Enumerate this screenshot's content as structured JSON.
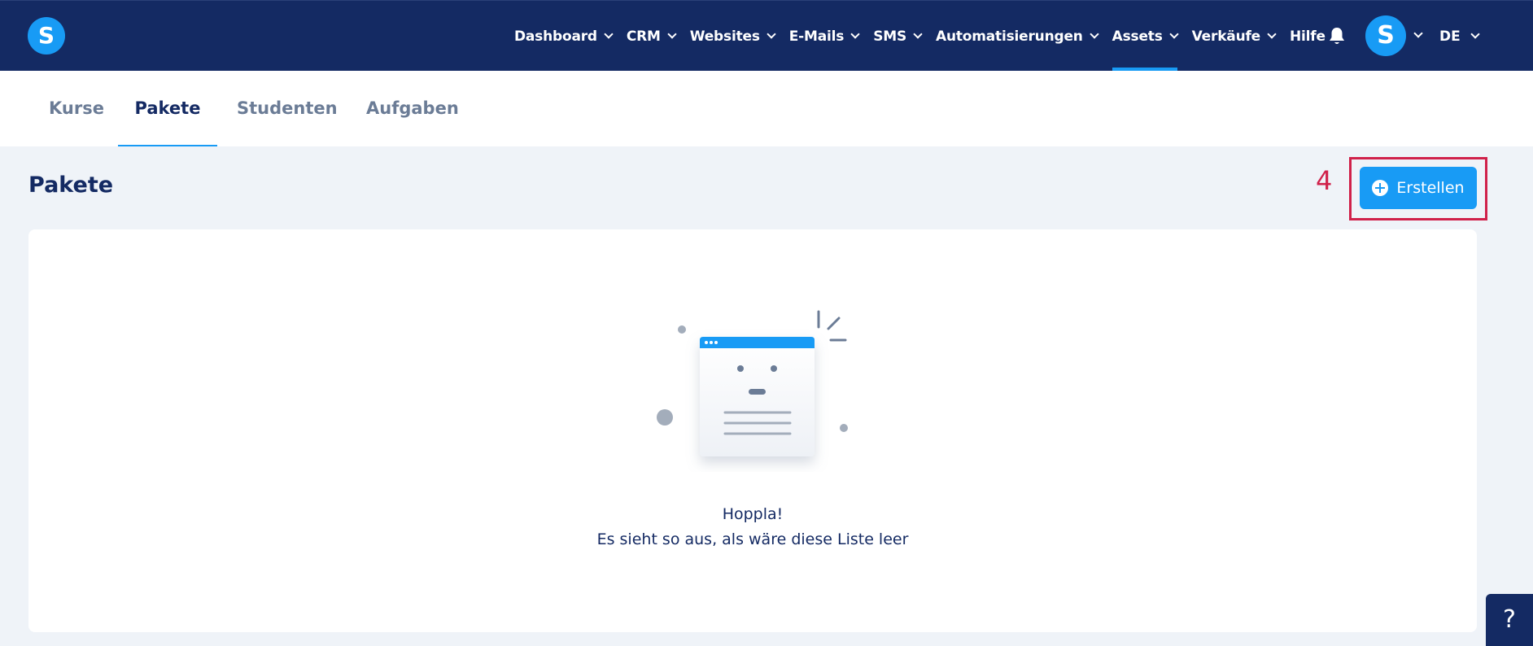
{
  "header": {
    "logo_letter": "S",
    "nav": [
      {
        "label": "Dashboard"
      },
      {
        "label": "CRM"
      },
      {
        "label": "Websites"
      },
      {
        "label": "E-Mails"
      },
      {
        "label": "SMS"
      },
      {
        "label": "Automatisierungen"
      },
      {
        "label": "Assets",
        "active": true
      },
      {
        "label": "Verkäufe"
      },
      {
        "label": "Hilfe"
      }
    ],
    "avatar_letter": "S",
    "language": "DE",
    "icons": [
      "bell-icon",
      "chevron-down-icon"
    ]
  },
  "tabs": [
    {
      "label": "Kurse"
    },
    {
      "label": "Pakete",
      "active": true
    },
    {
      "label": "Studenten"
    },
    {
      "label": "Aufgaben"
    }
  ],
  "page": {
    "title": "Pakete",
    "step_number": "4",
    "create_button_label": "Erstellen"
  },
  "empty_state": {
    "title": "Hoppla!",
    "message": "Es sieht so aus, als wäre diese Liste leer"
  },
  "help_button_label": "?",
  "colors": {
    "nav_bg": "#142a63",
    "accent": "#189bf5",
    "highlight": "#d0214a",
    "page_bg": "#eff3f8"
  }
}
